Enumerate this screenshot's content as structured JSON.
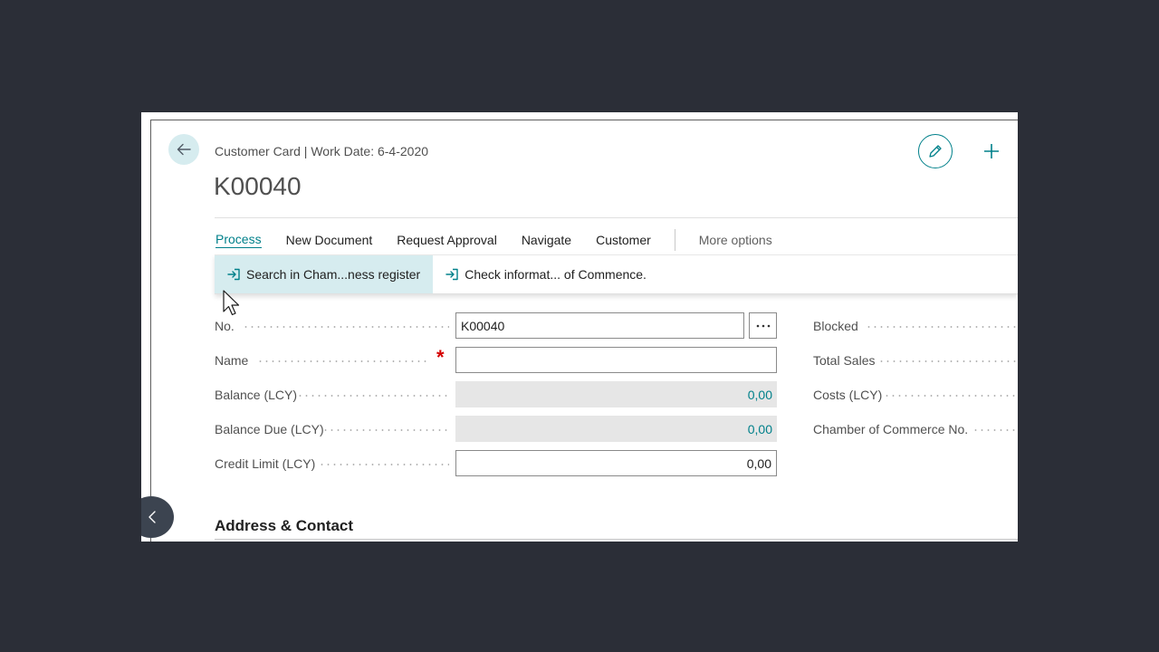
{
  "header": {
    "caption": "Customer Card | Work Date: 6-4-2020",
    "title": "K00040"
  },
  "action_bar": {
    "tabs": [
      {
        "label": "Process",
        "active": true
      },
      {
        "label": "New Document"
      },
      {
        "label": "Request Approval"
      },
      {
        "label": "Navigate"
      },
      {
        "label": "Customer"
      }
    ],
    "more_label": "More options"
  },
  "sub_actions": [
    {
      "label": "Search in Cham...ness register",
      "icon": "action-arrow-icon"
    },
    {
      "label": "Check informat... of Commence.",
      "icon": "action-arrow-icon"
    }
  ],
  "fields": {
    "no": {
      "label": "No.",
      "value": "K00040"
    },
    "name": {
      "label": "Name",
      "value": ""
    },
    "balance": {
      "label": "Balance (LCY)",
      "value": "0,00"
    },
    "balance_due": {
      "label": "Balance Due (LCY)",
      "value": "0,00"
    },
    "credit_limit": {
      "label": "Credit Limit (LCY)",
      "value": "0,00"
    }
  },
  "right_fields": {
    "blocked": "Blocked",
    "total_sales": "Total Sales",
    "costs": "Costs (LCY)",
    "chamber_no": "Chamber of Commerce No."
  },
  "section": {
    "address_title": "Address & Contact"
  },
  "colors": {
    "accent": "#00808a",
    "hover_bg": "#d6ecef",
    "required": "#d40000",
    "backdrop": "#2b2e37"
  }
}
